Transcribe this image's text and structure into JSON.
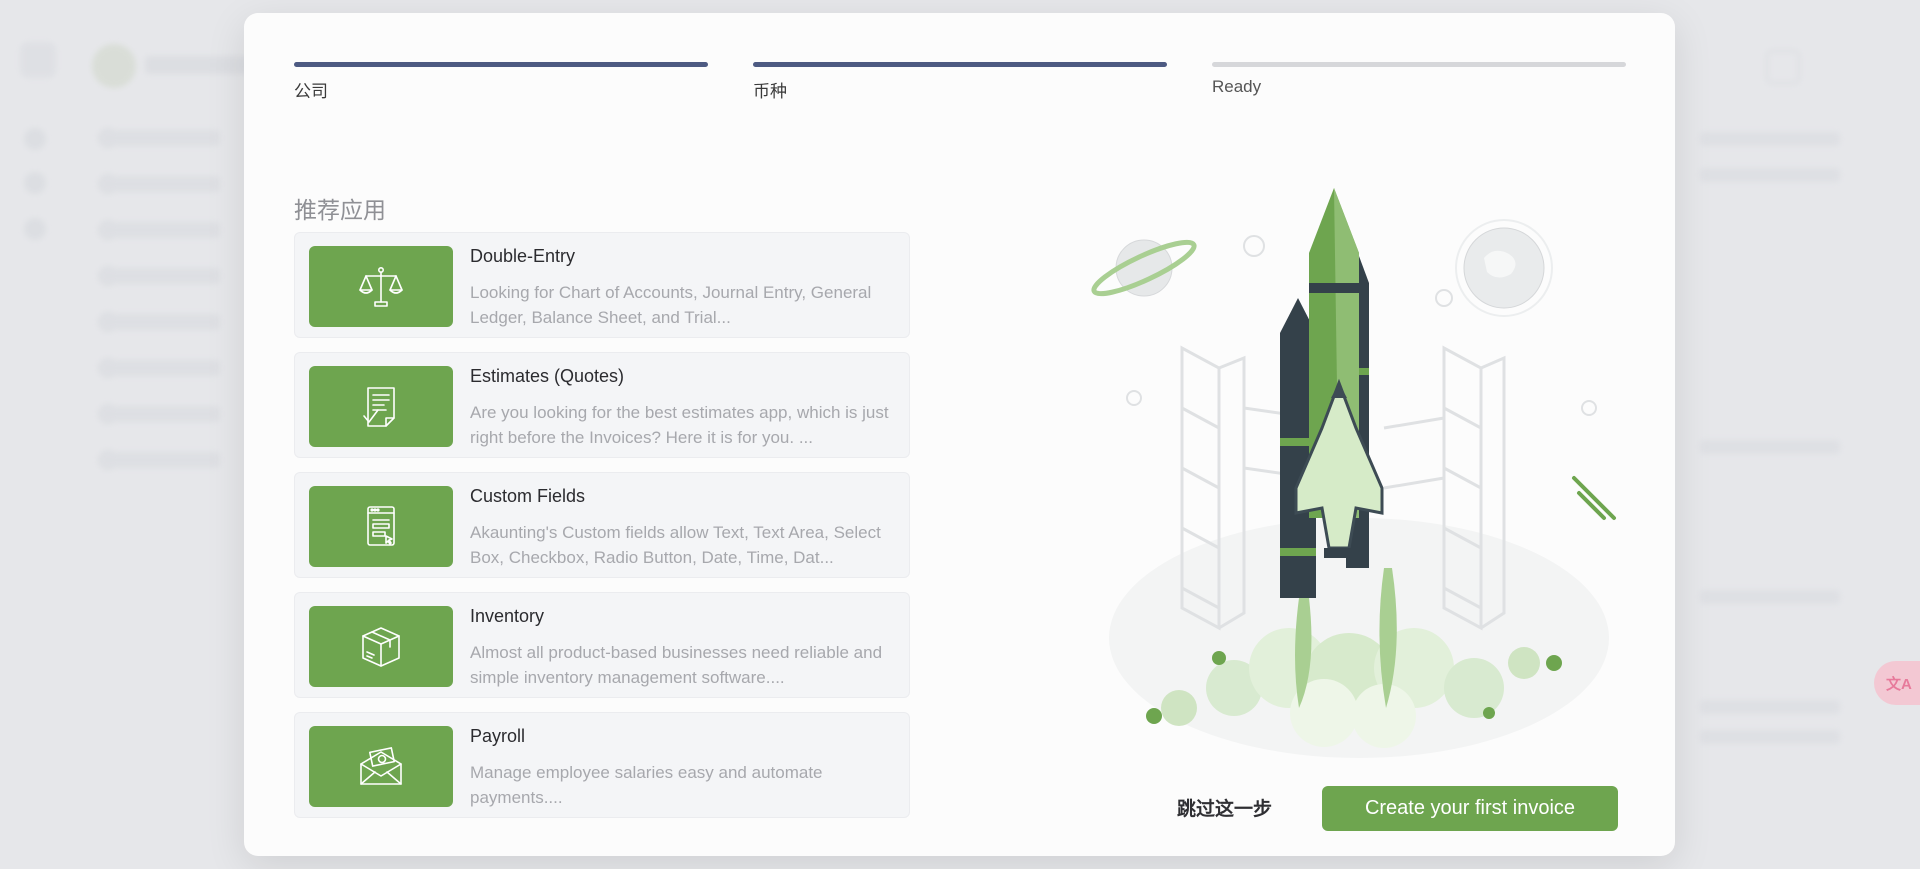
{
  "wizard": {
    "steps": [
      {
        "label": "公司",
        "state": "done"
      },
      {
        "label": "币种",
        "state": "done"
      },
      {
        "label": "Ready",
        "state": "pending"
      }
    ],
    "section_title": "推荐应用",
    "apps": [
      {
        "name": "Double-Entry",
        "description": "Looking for Chart of Accounts, Journal Entry, General Ledger, Balance Sheet, and Trial...",
        "icon": "scales-icon"
      },
      {
        "name": "Estimates (Quotes)",
        "description": "Are you looking for the best estimates app, which is just right before the Invoices? Here it is for you. ...",
        "icon": "checklist-document-icon"
      },
      {
        "name": "Custom Fields",
        "description": "Akaunting's Custom fields allow Text, Text Area, Select Box, Checkbox, Radio Button, Date, Time, Dat...",
        "icon": "form-window-icon"
      },
      {
        "name": "Inventory",
        "description": "Almost all product-based businesses need reliable and simple inventory management software....",
        "icon": "box-icon"
      },
      {
        "name": "Payroll",
        "description": "Manage employee salaries easy and automate payments....",
        "icon": "money-envelope-icon"
      }
    ],
    "skip_label": "跳过这一步",
    "create_label": "Create your first invoice"
  },
  "colors": {
    "accent_green": "#6ea54f",
    "step_active": "#4d5a82",
    "step_inactive": "#d6d7da"
  },
  "translate_button": {
    "icon": "translate-icon"
  }
}
